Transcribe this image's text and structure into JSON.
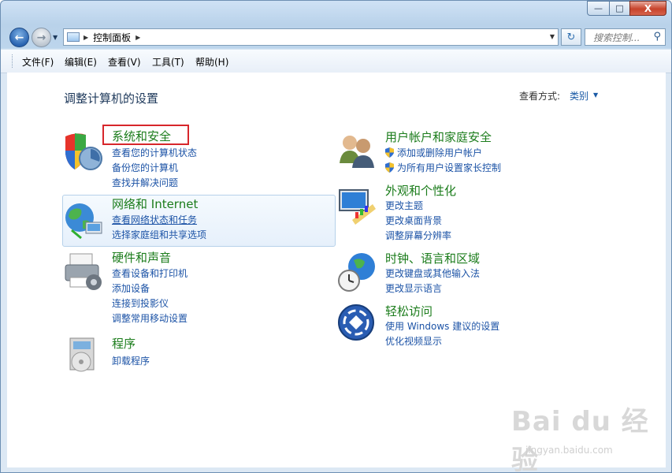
{
  "window": {
    "min_label": "—",
    "max_label": "□",
    "close_label": "X"
  },
  "nav": {
    "address_path": "控制面板",
    "search_placeholder": "搜索控制...",
    "refresh_label": "↻"
  },
  "menu": [
    {
      "label": "文件(F)"
    },
    {
      "label": "编辑(E)"
    },
    {
      "label": "查看(V)"
    },
    {
      "label": "工具(T)"
    },
    {
      "label": "帮助(H)"
    }
  ],
  "main": {
    "title": "调整计算机的设置",
    "view_by_label": "查看方式:",
    "view_by_value": "类别"
  },
  "categories": [
    {
      "title": "系统和安全",
      "icon": "shield-icon",
      "links": [
        "查看您的计算机状态",
        "备份您的计算机",
        "查找并解决问题"
      ]
    },
    {
      "title": "网络和 Internet",
      "icon": "network-globe-icon",
      "links": [
        "查看网络状态和任务",
        "选择家庭组和共享选项"
      ]
    },
    {
      "title": "硬件和声音",
      "icon": "printer-icon",
      "links": [
        "查看设备和打印机",
        "添加设备",
        "连接到投影仪",
        "调整常用移动设置"
      ]
    },
    {
      "title": "程序",
      "icon": "programs-icon",
      "links": [
        "卸载程序"
      ]
    },
    {
      "title": "用户帐户和家庭安全",
      "icon": "users-icon",
      "links": [
        "添加或删除用户帐户",
        "为所有用户设置家长控制"
      ]
    },
    {
      "title": "外观和个性化",
      "icon": "monitor-palette-icon",
      "links": [
        "更改主题",
        "更改桌面背景",
        "调整屏幕分辨率"
      ]
    },
    {
      "title": "时钟、语言和区域",
      "icon": "clock-globe-icon",
      "links": [
        "更改键盘或其他输入法",
        "更改显示语言"
      ]
    },
    {
      "title": "轻松访问",
      "icon": "ease-of-access-icon",
      "links": [
        "使用 Windows 建议的设置",
        "优化视频显示"
      ]
    }
  ],
  "watermark": {
    "brand": "Bai du 经验",
    "url": "jingyan.baidu.com"
  },
  "colors": {
    "category_title": "#1b7c1b",
    "link": "#1c53a6",
    "highlight_box": "#d7262b"
  }
}
